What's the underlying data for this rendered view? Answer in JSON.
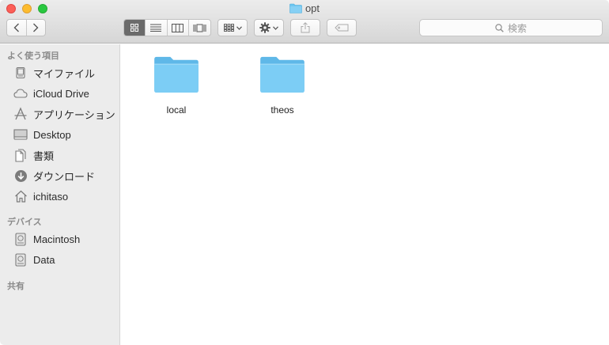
{
  "window": {
    "title": "opt"
  },
  "toolbar": {
    "search_placeholder": "検索"
  },
  "sidebar": {
    "favorites_header": "よく使う項目",
    "favorites": [
      {
        "label": "マイファイル",
        "icon": "all-files-icon"
      },
      {
        "label": "iCloud Drive",
        "icon": "cloud-icon"
      },
      {
        "label": "アプリケーション",
        "icon": "applications-icon"
      },
      {
        "label": "Desktop",
        "icon": "desktop-icon"
      },
      {
        "label": "書類",
        "icon": "documents-icon"
      },
      {
        "label": "ダウンロード",
        "icon": "downloads-icon"
      },
      {
        "label": "ichitaso",
        "icon": "home-icon"
      }
    ],
    "devices_header": "デバイス",
    "devices": [
      {
        "label": "Macintosh",
        "icon": "disk-icon"
      },
      {
        "label": "Data",
        "icon": "disk-icon"
      }
    ],
    "shared_header": "共有"
  },
  "content": {
    "items": [
      {
        "name": "local",
        "icon": "folder-icon"
      },
      {
        "name": "theos",
        "icon": "folder-icon"
      }
    ]
  },
  "colors": {
    "folder": "#6ec6f0",
    "folder_tab": "#8fd3f5",
    "close": "#fc5f57",
    "minimize": "#fdbc2e",
    "maximize": "#29c840"
  }
}
